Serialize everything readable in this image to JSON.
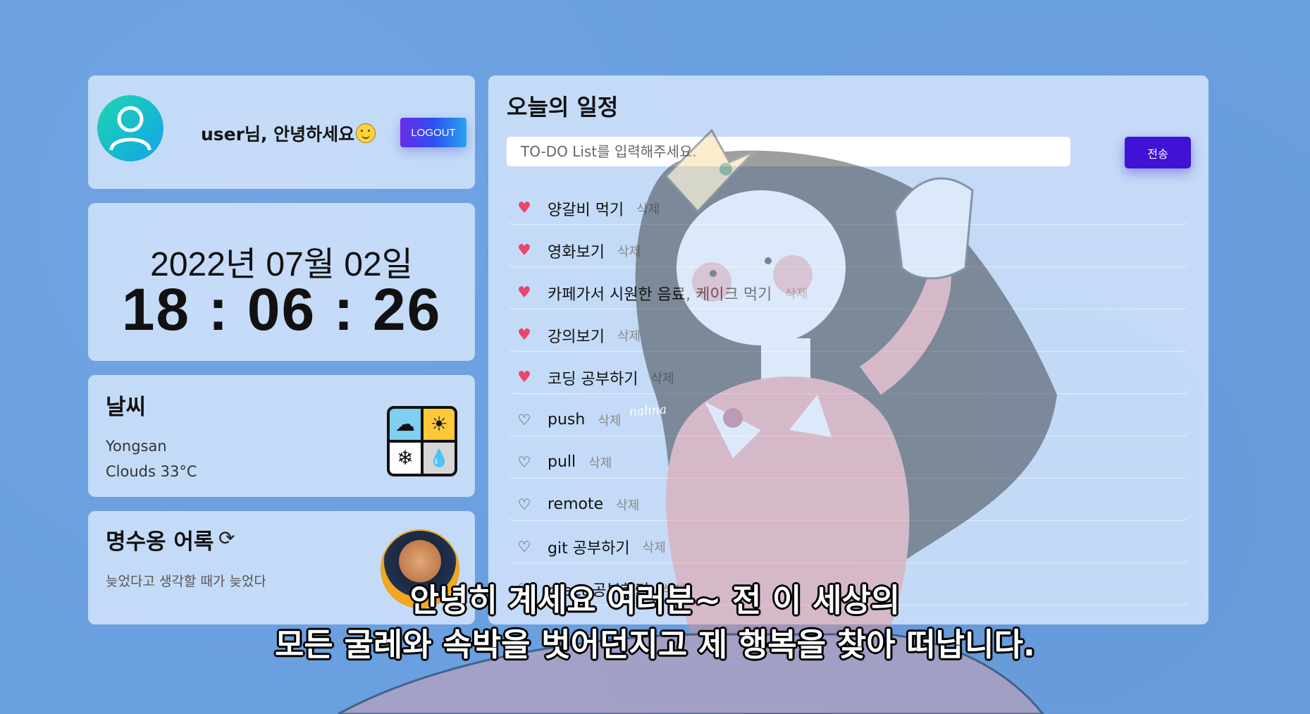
{
  "user": {
    "greeting": "user님, 안녕하세요",
    "logout_label": "LOGOUT"
  },
  "clock": {
    "date": "2022년 07월 02일",
    "time": "18 : 06 : 26"
  },
  "weather": {
    "title": "날씨",
    "city": "Yongsan",
    "description": "Clouds 33°C"
  },
  "quote": {
    "title": "명수옹 어록",
    "text": "늦었다고 생각할 때가 늦었다"
  },
  "todo": {
    "title": "오늘의 일정",
    "input_placeholder": "TO-DO List를 입력해주세요.",
    "send_label": "전송",
    "delete_label": "삭제",
    "items": [
      {
        "text": "양갈비 먹기",
        "liked": true
      },
      {
        "text": "영화보기",
        "liked": true
      },
      {
        "text": "카페가서 시원한 음료, 케이크 먹기",
        "liked": true
      },
      {
        "text": "강의보기",
        "liked": true
      },
      {
        "text": "코딩 공부하기",
        "liked": true
      },
      {
        "text": "push",
        "liked": false
      },
      {
        "text": "pull",
        "liked": false
      },
      {
        "text": "remote",
        "liked": false
      },
      {
        "text": "git 공부하기",
        "liked": false
      },
      {
        "text": "react 공부하기",
        "liked": false
      }
    ]
  },
  "overlay": {
    "watermark": "nalina",
    "subtitle_line1": "안녕히 계세요 여러분~ 전 이 세상의",
    "subtitle_line2": "모든 굴레와 속박을 벗어던지고 제 행복을 찾아 떠납니다."
  }
}
